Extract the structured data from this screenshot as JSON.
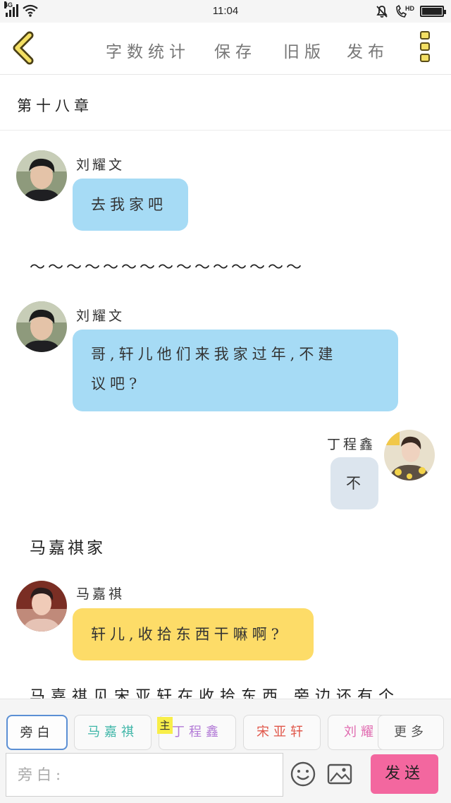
{
  "status_bar": {
    "network": "4G",
    "time": "11:04",
    "hd": "HD"
  },
  "toolbar": {
    "word_count": "字数统计",
    "save": "保存",
    "old_version": "旧版",
    "publish": "发布"
  },
  "chapter_title": "第十八章",
  "messages": [
    {
      "speaker": "刘耀文",
      "text": "去我家吧"
    },
    {
      "speaker": "刘耀文",
      "text_line1": "哥,轩儿他们来我家过年,不建",
      "text_line2": "议吧?"
    },
    {
      "speaker": "丁程鑫",
      "text": "不"
    },
    {
      "speaker": "马嘉祺",
      "text": "轩儿,收拾东西干嘛啊?"
    }
  ],
  "divider": "～～～～～～～～～～～～～～～",
  "narration_scene": "马嘉祺家",
  "narration_partial": "马嘉祺见宋亚轩在收拾东西,旁边还有个",
  "role_bar": {
    "roles": [
      {
        "label": "旁白",
        "color": "#555555"
      },
      {
        "label": "马嘉祺",
        "color": "#3fb6a8"
      },
      {
        "label": "丁程鑫",
        "color": "#b27ad6"
      },
      {
        "label": "宋亚轩",
        "color": "#e0574a"
      },
      {
        "label": "刘耀",
        "color": "#e06bb0"
      }
    ],
    "more": "更多",
    "main_tag": "主",
    "input_placeholder": "旁白:",
    "send": "发送"
  },
  "colors": {
    "bubble_blue": "#a6dbf5",
    "bubble_grey": "#dce5ee",
    "bubble_yellow": "#fddc68",
    "send_pink": "#f3679f",
    "accent_yellow": "#f3df63"
  }
}
